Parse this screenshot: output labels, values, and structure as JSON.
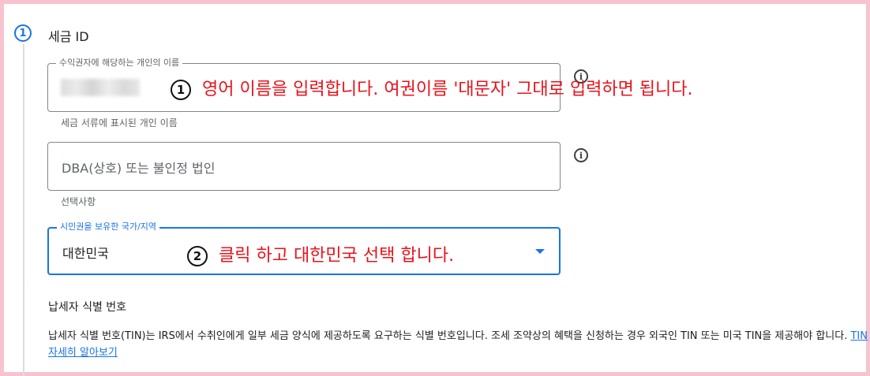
{
  "step": {
    "number": "1",
    "title": "세금 ID"
  },
  "name_field": {
    "legend": "수익권자에 해당하는 개인의 이름",
    "helper": "세금 서류에 표시된 개인 이름",
    "info_icon": "info-icon"
  },
  "dba_field": {
    "placeholder": "DBA(상호) 또는 불인정 법인",
    "helper": "선택사항",
    "info_icon": "info-icon"
  },
  "citizenship_field": {
    "legend": "시민권을 보유한 국가/지역",
    "value": "대한민국",
    "arrow_icon": "dropdown-arrow-icon"
  },
  "annotations": [
    {
      "number": "1",
      "text": "영어 이름을 입력합니다. 여권이름 '대문자' 그대로 입력하면 됩니다."
    },
    {
      "number": "2",
      "text": "클릭 하고 대한민국 선택 합니다."
    }
  ],
  "tin": {
    "title": "납세자 식별 번호",
    "description": "납세자 식별 번호(TIN)는 IRS에서 수취인에게 일부 세금 양식에 제공하도록 요구하는 식별 번호입니다. 조세 조약상의 혜택을 신청하는 경우 외국인 TIN 또는 미국 TIN을 제공해야 합니다. ",
    "link_text": "TIN 자세히 알아보기"
  },
  "colors": {
    "accent": "#1a73e8",
    "annotation": "#e8121b",
    "frame": "#f6c3cf"
  }
}
